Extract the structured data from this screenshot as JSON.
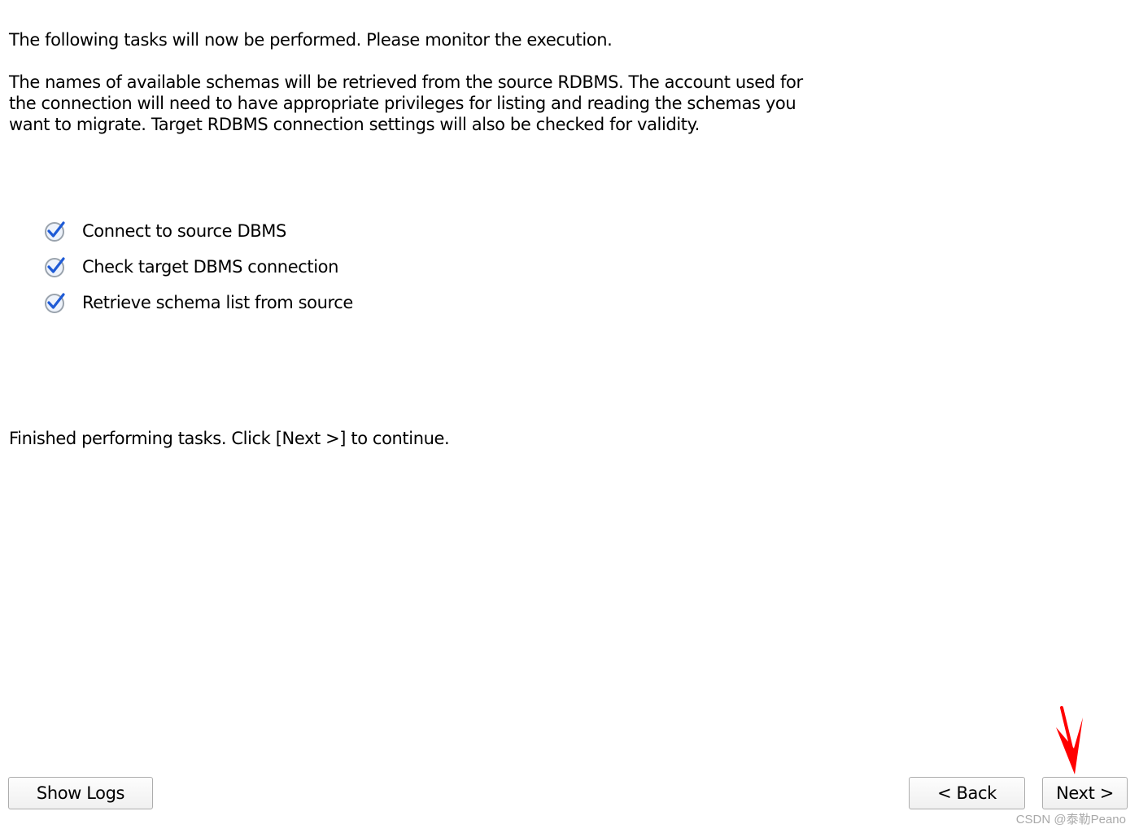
{
  "intro_text": "The following tasks will now be performed. Please monitor the execution.",
  "description_lines": [
    "The names of available schemas will be retrieved from the source RDBMS. The account used for",
    "the connection will need to have appropriate privileges for listing and reading the schemas you",
    "want to migrate. Target RDBMS connection settings will also be checked for validity."
  ],
  "tasks": [
    {
      "label": "Connect to source DBMS",
      "status": "done",
      "icon": "checkmark-icon"
    },
    {
      "label": "Check target DBMS connection",
      "status": "done",
      "icon": "checkmark-icon"
    },
    {
      "label": "Retrieve schema list from source",
      "status": "done",
      "icon": "checkmark-icon"
    }
  ],
  "status_text": "Finished performing tasks. Click [Next >] to continue.",
  "buttons": {
    "show_logs": "Show Logs",
    "back": "< Back",
    "next": "Next >"
  },
  "annotation": {
    "icon": "red-arrow-icon",
    "color": "#ff0000"
  },
  "watermark": "CSDN @泰勒Peano",
  "colors": {
    "check_blue": "#1f5bd6",
    "check_ring": "#9aa3ad",
    "button_border": "#adadad"
  }
}
